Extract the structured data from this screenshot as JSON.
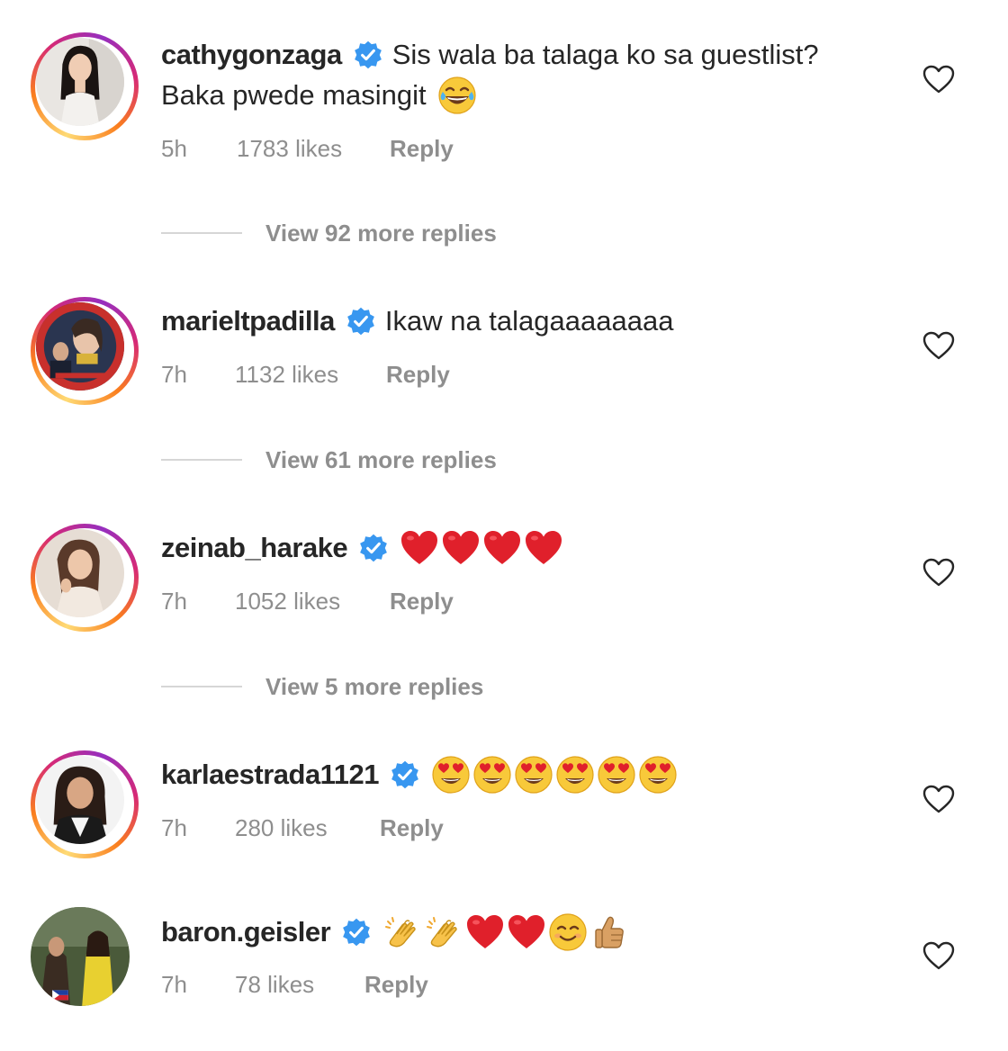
{
  "colors": {
    "verified_blue": "#3897f0",
    "text": "#262626",
    "secondary": "#8e8e8e",
    "heart_red": "#e0202b"
  },
  "comments": [
    {
      "username": "cathygonzaga",
      "text_line1": "Sis wala ba talaga ko sa guestlist?",
      "text_line2": "Baka pwede masingit",
      "time": "5h",
      "likes": "1783 likes",
      "reply": "Reply",
      "view_replies": "View 92 more replies",
      "emojis": [
        "face-with-tears-of-joy"
      ]
    },
    {
      "username": "marieltpadilla",
      "text_line1": "Ikaw na talagaaaaaaaa",
      "time": "7h",
      "likes": "1132 likes",
      "reply": "Reply",
      "view_replies": "View 61 more replies"
    },
    {
      "username": "zeinab_harake",
      "time": "7h",
      "likes": "1052 likes",
      "reply": "Reply",
      "view_replies": "View 5 more replies",
      "emojis": [
        "red-heart",
        "red-heart",
        "red-heart",
        "red-heart"
      ]
    },
    {
      "username": "karlaestrada1121",
      "time": "7h",
      "likes": "280 likes",
      "reply": "Reply",
      "emojis": [
        "heart-eyes",
        "heart-eyes",
        "heart-eyes",
        "heart-eyes",
        "heart-eyes",
        "heart-eyes"
      ]
    },
    {
      "username": "baron.geisler",
      "time": "7h",
      "likes": "78 likes",
      "reply": "Reply",
      "emojis": [
        "clapping-hands",
        "clapping-hands",
        "red-heart",
        "red-heart",
        "smiling-face",
        "thumbs-up"
      ]
    }
  ]
}
